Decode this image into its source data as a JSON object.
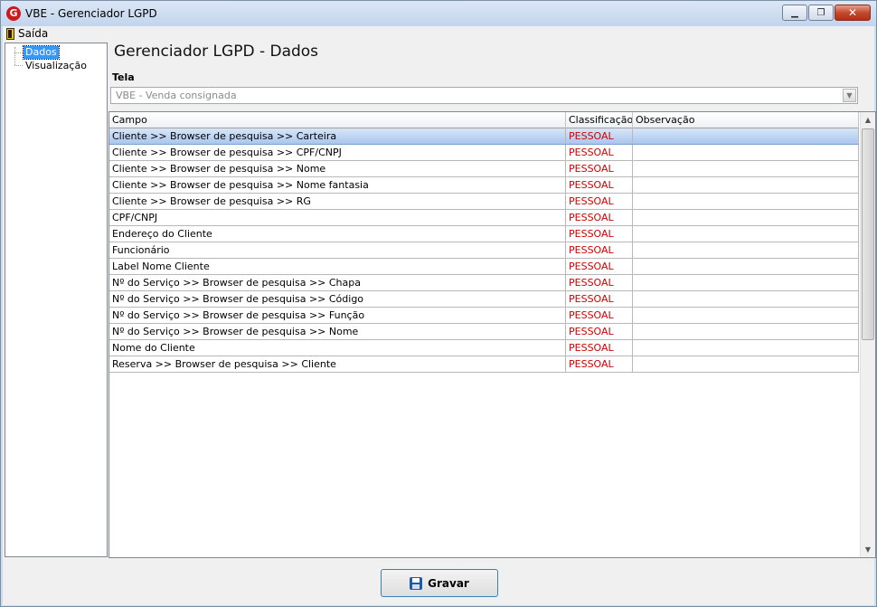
{
  "window": {
    "title": "VBE - Gerenciador LGPD",
    "icon": "G"
  },
  "menu": {
    "saida": "Saída"
  },
  "tree": {
    "items": [
      {
        "label": "Dados",
        "selected": true
      },
      {
        "label": "Visualização",
        "selected": false
      }
    ]
  },
  "main": {
    "title": "Gerenciador LGPD - Dados",
    "tela_label": "Tela",
    "tela_value": "VBE - Venda consignada"
  },
  "grid": {
    "columns": [
      "Campo",
      "Classificação",
      "Observação"
    ],
    "rows": [
      {
        "campo": "Cliente >> Browser de pesquisa >> Carteira",
        "classificacao": "PESSOAL",
        "observacao": ""
      },
      {
        "campo": "Cliente >> Browser de pesquisa >> CPF/CNPJ",
        "classificacao": "PESSOAL",
        "observacao": ""
      },
      {
        "campo": "Cliente >> Browser de pesquisa >> Nome",
        "classificacao": "PESSOAL",
        "observacao": ""
      },
      {
        "campo": "Cliente >> Browser de pesquisa >> Nome fantasia",
        "classificacao": "PESSOAL",
        "observacao": ""
      },
      {
        "campo": "Cliente >> Browser de pesquisa >> RG",
        "classificacao": "PESSOAL",
        "observacao": ""
      },
      {
        "campo": "CPF/CNPJ",
        "classificacao": "PESSOAL",
        "observacao": ""
      },
      {
        "campo": "Endereço do Cliente",
        "classificacao": "PESSOAL",
        "observacao": ""
      },
      {
        "campo": "Funcionário",
        "classificacao": "PESSOAL",
        "observacao": ""
      },
      {
        "campo": "Label Nome Cliente",
        "classificacao": "PESSOAL",
        "observacao": ""
      },
      {
        "campo": "Nº do Serviço >> Browser de pesquisa >> Chapa",
        "classificacao": "PESSOAL",
        "observacao": ""
      },
      {
        "campo": "Nº do Serviço >> Browser de pesquisa >> Código",
        "classificacao": "PESSOAL",
        "observacao": ""
      },
      {
        "campo": "Nº do Serviço >> Browser de pesquisa >> Função",
        "classificacao": "PESSOAL",
        "observacao": ""
      },
      {
        "campo": "Nº do Serviço >> Browser de pesquisa >> Nome",
        "classificacao": "PESSOAL",
        "observacao": ""
      },
      {
        "campo": "Nome do Cliente",
        "classificacao": "PESSOAL",
        "observacao": ""
      },
      {
        "campo": "Reserva >> Browser de pesquisa >> Cliente",
        "classificacao": "PESSOAL",
        "observacao": ""
      }
    ],
    "selected_row": 0
  },
  "footer": {
    "gravar_label": "Gravar"
  },
  "colors": {
    "classificacao_text": "#d20000",
    "selection": "#3399ff"
  }
}
